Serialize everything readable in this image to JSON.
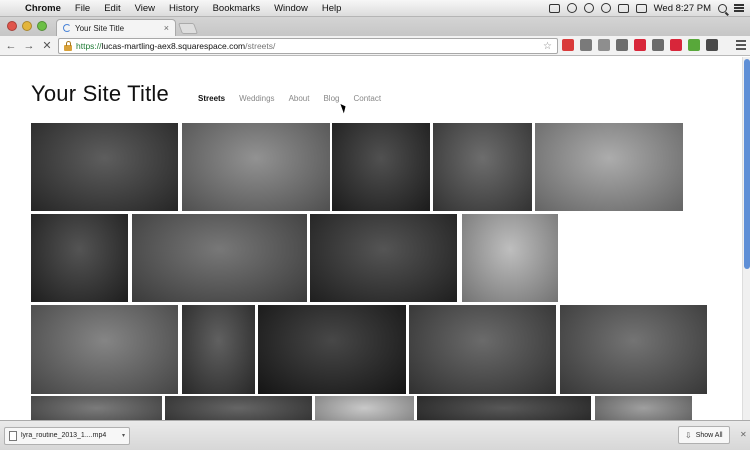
{
  "menubar": {
    "apple": "",
    "items": [
      "Chrome",
      "File",
      "Edit",
      "View",
      "History",
      "Bookmarks",
      "Window",
      "Help"
    ],
    "clock": "Wed 8:27 PM"
  },
  "browser": {
    "tab_title": "Your Site Title",
    "tab_close": "×",
    "back": "←",
    "forward": "→",
    "stop": "✕",
    "url_scheme": "https://",
    "url_host": "lucas-martling-aex8.squarespace.com",
    "url_path": "/streets/",
    "star": "☆",
    "extensions": [
      "#d93a3a",
      "#7a7a7a",
      "#8e8e8e",
      "#6d6d6d",
      "#d8263a",
      "#6b6b6b",
      "#d8263a",
      "#58a83a",
      "#4a4a4a"
    ]
  },
  "site": {
    "title": "Your Site Title",
    "nav": [
      "Streets",
      "Weddings",
      "About",
      "Blog",
      "Contact"
    ],
    "active_nav": "Streets"
  },
  "gallery": {
    "tones": [
      "#3a3a3a",
      "#7a7a7a",
      "#2a2a2a",
      "#4d4d4d",
      "#9a9a9a",
      "#2e2e2e",
      "#5a5a5a",
      "#2f2f2f",
      "#b0b0b0",
      "#6a6a6a",
      "#3d3d3d",
      "#1f1f1f",
      "#4a4a4a",
      "#555555",
      "#5e5e5e",
      "#444444",
      "#bdbdbd",
      "#333333",
      "#8a8a8a"
    ]
  },
  "downloads": {
    "file_name": "lyra_routine_2013_1....mp4",
    "arrow": "▾",
    "show_all": "Show All",
    "close": "✕"
  }
}
